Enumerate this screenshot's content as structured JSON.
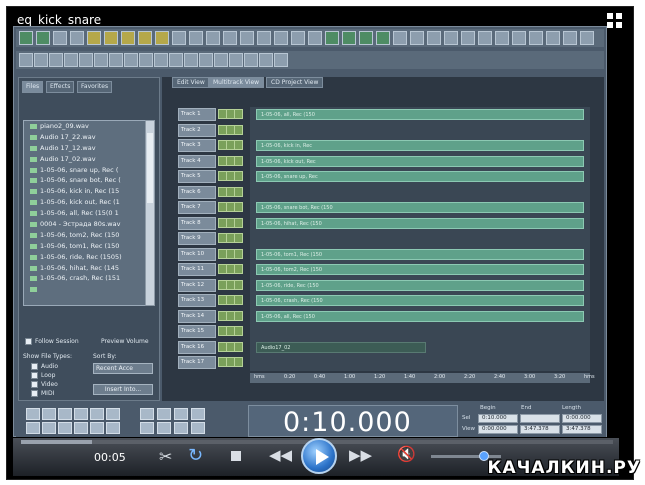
{
  "video": {
    "title": "eq_kick_snare"
  },
  "app": {
    "panel_tabs": [
      "Files",
      "Effects",
      "Favorites"
    ],
    "files": [
      "piano2_09.wav",
      "Audio 17_22.wav",
      "Audio 17_12.wav",
      "Audio 17_02.wav",
      "1-05-06, snare up, Rec (",
      "1-05-06, snare bot, Rec (",
      "1-05-06, kick in, Rec (15",
      "1-05-06, kick out, Rec (1",
      "1-05-06, all, Rec (15(0 1",
      "0004 - Эстрада 80s.wav",
      "1-05-06, tom2, Rec (150",
      "1-05-06, tom1, Rec (150",
      "1-05-06, ride, Rec (1505)",
      "1-05-06, hihat, Rec (145",
      "1-05-06, crash, Rec (151"
    ],
    "follow_session_label": "Follow Session",
    "preview_volume_label": "Preview Volume",
    "show_file_types_label": "Show File Types:",
    "file_types": [
      "Audio",
      "Loop",
      "Video",
      "MIDI"
    ],
    "sort_by_label": "Sort By:",
    "sort_by_value": "Recent Acce",
    "insert_button": "Insert Into...",
    "view_tabs": [
      "Edit View",
      "Multitrack View",
      "CD Project View"
    ],
    "tracks": [
      {
        "name": "Track 1",
        "clip": "1-05-06, all, Rec (150"
      },
      {
        "name": "Track 2",
        "clip": ""
      },
      {
        "name": "Track 3",
        "clip": "1-05-06, kick in, Rec"
      },
      {
        "name": "Track 4",
        "clip": "1-05-06, kick out, Rec"
      },
      {
        "name": "Track 5",
        "clip": "1-05-06, snare up, Rec"
      },
      {
        "name": "Track 6",
        "clip": ""
      },
      {
        "name": "Track 7",
        "clip": "1-05-06, snare bot, Rec (150"
      },
      {
        "name": "Track 8",
        "clip": "1-05-06, hihat, Rec (150"
      },
      {
        "name": "Track 9",
        "clip": ""
      },
      {
        "name": "Track 10",
        "clip": "1-05-06, tom1, Rec (150"
      },
      {
        "name": "Track 11",
        "clip": "1-05-06, tom2, Rec (150"
      },
      {
        "name": "Track 12",
        "clip": "1-05-06, ride, Rec (150"
      },
      {
        "name": "Track 13",
        "clip": "1-05-06, crash, Rec (150"
      },
      {
        "name": "Track 14",
        "clip": "1-05-06, all, Rec (150"
      },
      {
        "name": "Track 15",
        "clip": ""
      },
      {
        "name": "Track 16",
        "clip": "Audio17_02"
      },
      {
        "name": "Track 17",
        "clip": ""
      }
    ],
    "ruler_ticks": [
      "hms",
      "0:20",
      "0:40",
      "1:00",
      "1:20",
      "1:40",
      "2:00",
      "2:20",
      "2:40",
      "3:00",
      "3:20",
      "hms"
    ],
    "time_display": "0:10.000",
    "selection": {
      "headers": [
        "Begin",
        "End",
        "Length"
      ],
      "sel_label": "Sel",
      "view_label": "View",
      "sel_values": [
        "0:10.000",
        "",
        "0:00.000"
      ],
      "view_values": [
        "0:00.000",
        "3:47.378",
        "3:47.378"
      ]
    }
  },
  "player": {
    "current_time": "00:05",
    "progress": 0.12,
    "volume": 0.75
  },
  "watermark": "КАЧАЛКИН.РУ",
  "colors": {
    "app_bg": "#4b5a6b",
    "clip": "#5fa18a",
    "play_button": "#2c73c9"
  }
}
